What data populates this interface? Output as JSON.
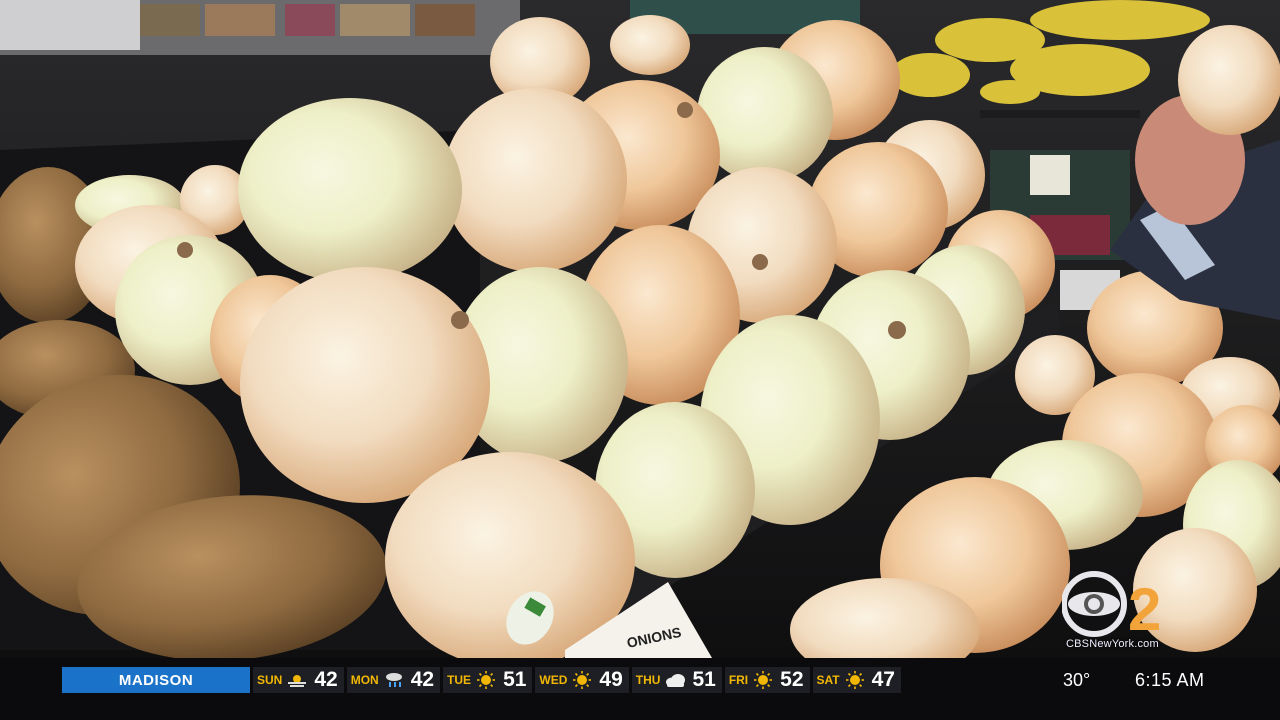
{
  "scene": {
    "description_free": true,
    "sign_text": "ONIONS"
  },
  "station": {
    "logo_number": "2",
    "website": "CBSNewYork.com"
  },
  "ticker": {
    "location": "MADISON",
    "forecast": [
      {
        "day": "SUN",
        "icon": "fog-icon",
        "temp": "42"
      },
      {
        "day": "MON",
        "icon": "rain-icon",
        "temp": "42"
      },
      {
        "day": "TUE",
        "icon": "sun-icon",
        "temp": "51"
      },
      {
        "day": "WED",
        "icon": "sun-icon",
        "temp": "49"
      },
      {
        "day": "THU",
        "icon": "cloud-icon",
        "temp": "51"
      },
      {
        "day": "FRI",
        "icon": "sun-icon",
        "temp": "52"
      },
      {
        "day": "SAT",
        "icon": "sun-icon",
        "temp": "47"
      }
    ],
    "current_temp": "30°",
    "time": "6:15 AM"
  },
  "colors": {
    "location_bg": "#1a73c9",
    "day_label": "#f2b705",
    "sun": "#f2b705",
    "rain": "#4aa3ff",
    "onion_skin": "#f3dcc0"
  }
}
